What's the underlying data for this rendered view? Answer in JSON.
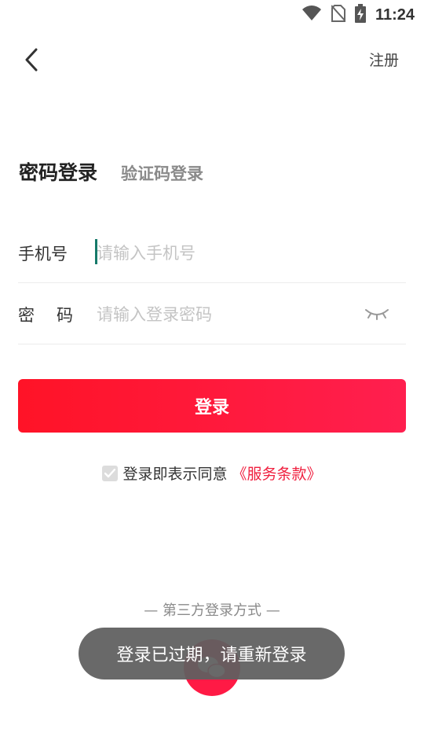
{
  "status_bar": {
    "time": "11:24",
    "icons": [
      "wifi-icon",
      "no-sim-icon",
      "battery-charging-icon"
    ]
  },
  "nav": {
    "back_icon": "chevron-left-icon",
    "register_label": "注册"
  },
  "tabs": [
    {
      "label": "密码登录",
      "active": true
    },
    {
      "label": "验证码登录",
      "active": false
    }
  ],
  "form": {
    "phone": {
      "label": "手机号",
      "placeholder": "请输入手机号",
      "value": ""
    },
    "password": {
      "label": "密码",
      "placeholder": "请输入登录密码",
      "value": "",
      "toggle_icon": "eye-closed-icon"
    }
  },
  "login_button": "登录",
  "agreement": {
    "checked": true,
    "text": "登录即表示同意",
    "link": "《服务条款》"
  },
  "third_party": {
    "label": "— 第三方登录方式 —",
    "wechat_icon": "wechat-icon"
  },
  "toast": "登录已过期，请重新登录",
  "colors": {
    "accent": "#ff1a45",
    "link": "#f0203f",
    "caret": "#167a6a"
  }
}
